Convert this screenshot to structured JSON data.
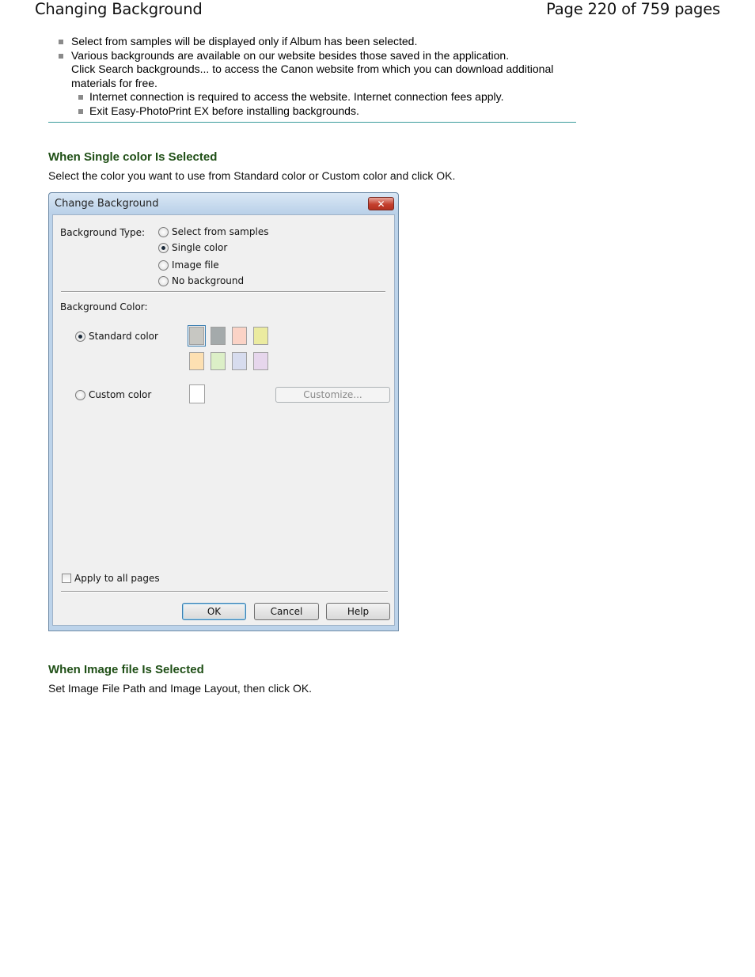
{
  "header": {
    "title": "Changing Background",
    "page_info": "Page 220 of 759 pages"
  },
  "notes": [
    "Select from samples will be displayed only if Album has been selected.",
    "Various backgrounds are available on our website besides those saved in the application.",
    "Click Search backgrounds... to access the Canon website from which you can download additional materials for free."
  ],
  "subnotes": [
    "Internet connection is required to access the website. Internet connection fees apply.",
    "Exit Easy-PhotoPrint EX before installing backgrounds."
  ],
  "section1": {
    "heading": "When Single color Is Selected",
    "text": "Select the color you want to use from Standard color or Custom color and click OK."
  },
  "dialog": {
    "title": "Change Background",
    "close_glyph": "✕",
    "background_type_label": "Background Type:",
    "type_options": [
      "Select from samples",
      "Single color",
      "Image file",
      "No background"
    ],
    "selected_type": "Single color",
    "background_color_label": "Background Color:",
    "standard_color_label": "Standard color",
    "custom_color_label": "Custom color",
    "selected_color_mode": "Standard color",
    "standard_colors": [
      "#c7c7c2",
      "#a4aaab",
      "#fbd3c6",
      "#ebeba0",
      "#fde0b2",
      "#dcefc7",
      "#d7dcee",
      "#e6d6ec"
    ],
    "customize_label": "Customize...",
    "apply_all_label": "Apply to all pages",
    "ok_label": "OK",
    "cancel_label": "Cancel",
    "help_label": "Help"
  },
  "section2": {
    "heading": "When Image file Is Selected",
    "text": "Set Image File Path and Image Layout, then click OK."
  }
}
